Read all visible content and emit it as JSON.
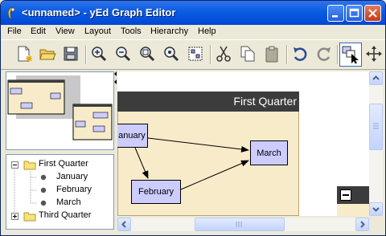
{
  "window": {
    "title": "<unnamed> - yEd Graph Editor",
    "title_color": "#0a5de3"
  },
  "menu": {
    "items": [
      {
        "label": "File",
        "name": "menu-file"
      },
      {
        "label": "Edit",
        "name": "menu-edit"
      },
      {
        "label": "View",
        "name": "menu-view"
      },
      {
        "label": "Layout",
        "name": "menu-layout"
      },
      {
        "label": "Tools",
        "name": "menu-tools"
      },
      {
        "label": "Hierarchy",
        "name": "menu-hierarchy"
      },
      {
        "label": "Help",
        "name": "menu-help"
      }
    ]
  },
  "toolbar": {
    "icons": [
      "new-document-icon",
      "open-folder-icon",
      "save-disk-icon",
      "zoom-in-icon",
      "zoom-out-icon",
      "zoom-fit-icon",
      "zoom-area-icon",
      "fit-content-icon",
      "cut-icon",
      "copy-icon",
      "paste-icon",
      "undo-icon",
      "redo-icon",
      "select-mode-icon",
      "pan-mode-icon"
    ]
  },
  "tree": {
    "items": [
      {
        "label": "First Quarter",
        "type": "group",
        "expanded": true
      },
      {
        "label": "January",
        "type": "node"
      },
      {
        "label": "February",
        "type": "node"
      },
      {
        "label": "March",
        "type": "node"
      },
      {
        "label": "Third Quarter",
        "type": "group",
        "expanded": false
      }
    ]
  },
  "graph": {
    "group_title": "First Quarter",
    "nodes": {
      "january": "anuary",
      "february": "February",
      "march": "March"
    },
    "colors": {
      "group_header": "#3c3c3c",
      "group_body": "#f8ebc9",
      "node_fill": "#ccccff"
    }
  }
}
